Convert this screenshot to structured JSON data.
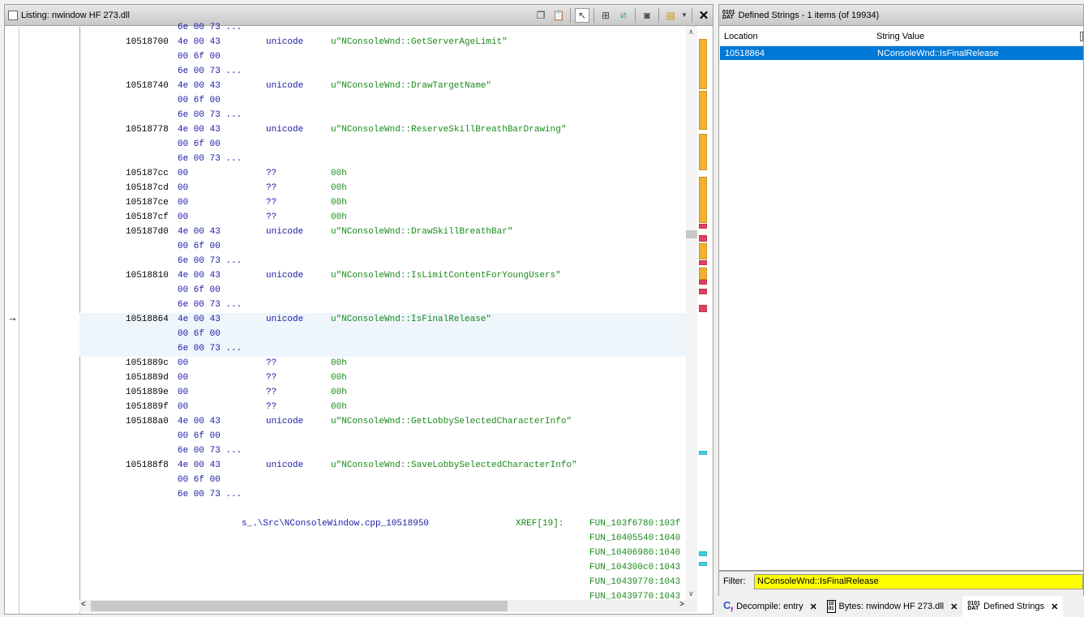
{
  "listing": {
    "title": "Listing:  nwindow HF 273.dll",
    "toolbar_icons": [
      "copy-icon",
      "paste-icon",
      "cursor-select-icon",
      "insert-icon",
      "diff-icon",
      "snapshot-icon",
      "layout-icon",
      "dropdown-icon",
      "close-icon"
    ],
    "rows": [
      {
        "addr": "",
        "bytes": "6e 00 73 ...",
        "mn": "",
        "op": ""
      },
      {
        "addr": "10518700",
        "bytes": "4e 00 43",
        "mn": "unicode",
        "op": "u\"NConsoleWnd::GetServerAgeLimit\""
      },
      {
        "addr": "",
        "bytes": "00 6f 00",
        "mn": "",
        "op": ""
      },
      {
        "addr": "",
        "bytes": "6e 00 73 ...",
        "mn": "",
        "op": ""
      },
      {
        "addr": "10518740",
        "bytes": "4e 00 43",
        "mn": "unicode",
        "op": "u\"NConsoleWnd::DrawTargetName\""
      },
      {
        "addr": "",
        "bytes": "00 6f 00",
        "mn": "",
        "op": ""
      },
      {
        "addr": "",
        "bytes": "6e 00 73 ...",
        "mn": "",
        "op": ""
      },
      {
        "addr": "10518778",
        "bytes": "4e 00 43",
        "mn": "unicode",
        "op": "u\"NConsoleWnd::ReserveSkillBreathBarDrawing\""
      },
      {
        "addr": "",
        "bytes": "00 6f 00",
        "mn": "",
        "op": ""
      },
      {
        "addr": "",
        "bytes": "6e 00 73 ...",
        "mn": "",
        "op": ""
      },
      {
        "addr": "105187cc",
        "bytes": "00",
        "mn": "??",
        "op": "00h"
      },
      {
        "addr": "105187cd",
        "bytes": "00",
        "mn": "??",
        "op": "00h"
      },
      {
        "addr": "105187ce",
        "bytes": "00",
        "mn": "??",
        "op": "00h"
      },
      {
        "addr": "105187cf",
        "bytes": "00",
        "mn": "??",
        "op": "00h"
      },
      {
        "addr": "105187d0",
        "bytes": "4e 00 43",
        "mn": "unicode",
        "op": "u\"NConsoleWnd::DrawSkillBreathBar\""
      },
      {
        "addr": "",
        "bytes": "00 6f 00",
        "mn": "",
        "op": ""
      },
      {
        "addr": "",
        "bytes": "6e 00 73 ...",
        "mn": "",
        "op": ""
      },
      {
        "addr": "10518810",
        "bytes": "4e 00 43",
        "mn": "unicode",
        "op": "u\"NConsoleWnd::IsLimitContentForYoungUsers\""
      },
      {
        "addr": "",
        "bytes": "00 6f 00",
        "mn": "",
        "op": ""
      },
      {
        "addr": "",
        "bytes": "6e 00 73 ...",
        "mn": "",
        "op": ""
      },
      {
        "addr": "10518864",
        "bytes": "4e 00 43",
        "mn": "unicode",
        "op": "u\"NConsoleWnd::IsFinalRelease\""
      },
      {
        "addr": "",
        "bytes": "00 6f 00",
        "mn": "",
        "op": ""
      },
      {
        "addr": "",
        "bytes": "6e 00 73 ...",
        "mn": "",
        "op": ""
      },
      {
        "addr": "1051889c",
        "bytes": "00",
        "mn": "??",
        "op": "00h"
      },
      {
        "addr": "1051889d",
        "bytes": "00",
        "mn": "??",
        "op": "00h"
      },
      {
        "addr": "1051889e",
        "bytes": "00",
        "mn": "??",
        "op": "00h"
      },
      {
        "addr": "1051889f",
        "bytes": "00",
        "mn": "??",
        "op": "00h"
      },
      {
        "addr": "105188a0",
        "bytes": "4e 00 43",
        "mn": "unicode",
        "op": "u\"NConsoleWnd::GetLobbySelectedCharacterInfo\""
      },
      {
        "addr": "",
        "bytes": "00 6f 00",
        "mn": "",
        "op": ""
      },
      {
        "addr": "",
        "bytes": "6e 00 73 ...",
        "mn": "",
        "op": ""
      },
      {
        "addr": "105188f8",
        "bytes": "4e 00 43",
        "mn": "unicode",
        "op": "u\"NConsoleWnd::SaveLobbySelectedCharacterInfo\""
      },
      {
        "addr": "",
        "bytes": "00 6f 00",
        "mn": "",
        "op": ""
      },
      {
        "addr": "",
        "bytes": "6e 00 73 ...",
        "mn": "",
        "op": ""
      }
    ],
    "label": "s_.\\Src\\NConsoleWindow.cpp_10518950",
    "xref_label": "XREF[19]:",
    "xrefs": [
      "FUN_103f6780:103f",
      "FUN_10405540:1040",
      "FUN_10406980:1040",
      "FUN_104300c0:1043",
      "FUN_10439770:1043",
      "FUN_10439770:1043"
    ]
  },
  "strings": {
    "title": "Defined Strings - 1 items (of 19934)",
    "columns": [
      "Location",
      "String Value"
    ],
    "rows": [
      {
        "location": "10518864",
        "value": "NConsoleWnd::IsFinalRelease"
      }
    ],
    "filter_label": "Filter:",
    "filter_value": "NConsoleWnd::IsFinalRelease",
    "selection_color": "#0078d7",
    "filter_color": "#ffff00"
  },
  "tabs": [
    {
      "label": "Decompile: entry",
      "icon": "decompile-icon"
    },
    {
      "label": "Bytes: nwindow HF 273.dll",
      "icon": "bytes-icon"
    },
    {
      "label": "Defined Strings",
      "icon": "defined-strings-icon",
      "active": true
    }
  ]
}
